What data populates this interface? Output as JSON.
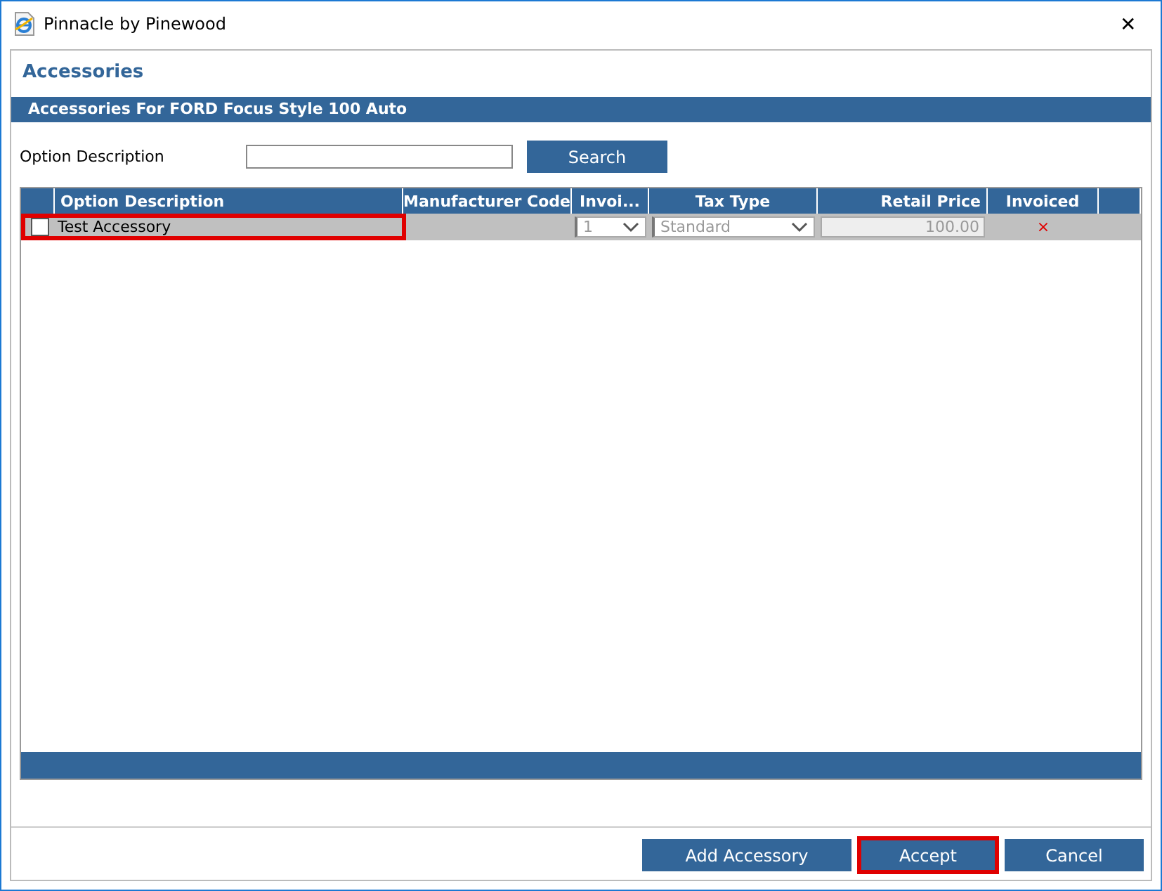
{
  "window": {
    "title": "Pinnacle by Pinewood",
    "close": "✕"
  },
  "page": {
    "heading": "Accessories",
    "subheading": "Accessories For FORD Focus Style 100 Auto"
  },
  "search": {
    "label": "Option Description",
    "button": "Search"
  },
  "table": {
    "columns": [
      "Option Description",
      "Manufacturer Code",
      "Invoi...",
      "Tax Type",
      "Retail Price",
      "Invoiced"
    ],
    "rows": [
      {
        "checked": false,
        "highlighted": true,
        "description": "Test Accessory",
        "invoice": "1",
        "tax_type": "Standard",
        "retail_price": "100.00",
        "invoiced": "×"
      }
    ]
  },
  "buttons": [
    {
      "label": "Add Accessory",
      "highlighted": false
    },
    {
      "label": "Accept",
      "highlighted": true
    },
    {
      "label": "Cancel",
      "highlighted": false
    }
  ]
}
